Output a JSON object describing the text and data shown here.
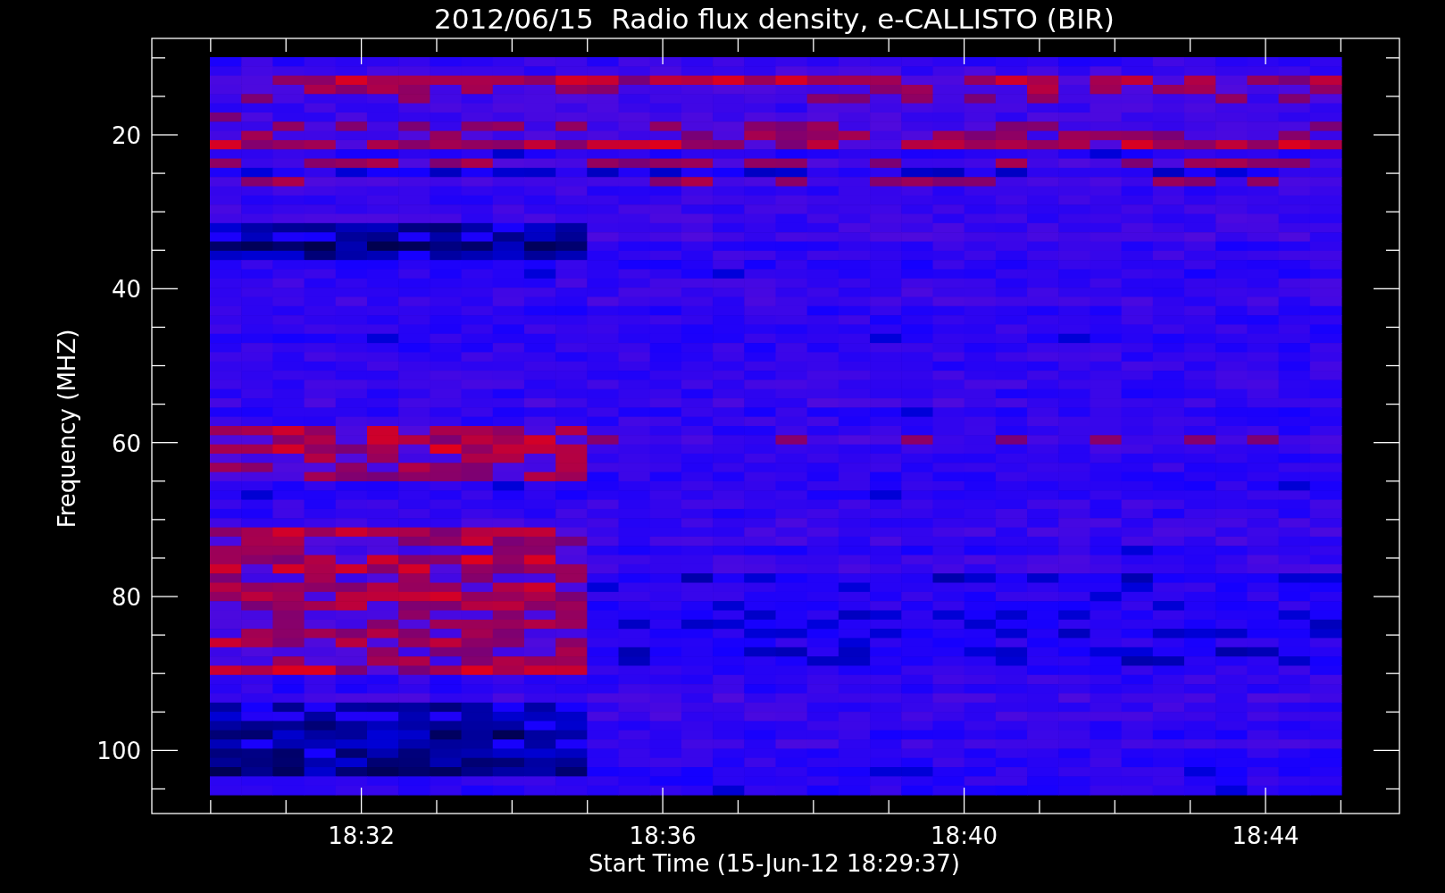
{
  "title": "2012/06/15  Radio flux density, e-CALLISTO (BIR)",
  "y_axis": {
    "label": "Frequency (MHZ)",
    "ticks": [
      "20",
      "40",
      "60",
      "80",
      "100"
    ]
  },
  "x_axis": {
    "label": "Start Time (15-Jun-12 18:29:37)",
    "ticks": [
      "18:32",
      "18:36",
      "18:40",
      "18:44"
    ]
  }
}
